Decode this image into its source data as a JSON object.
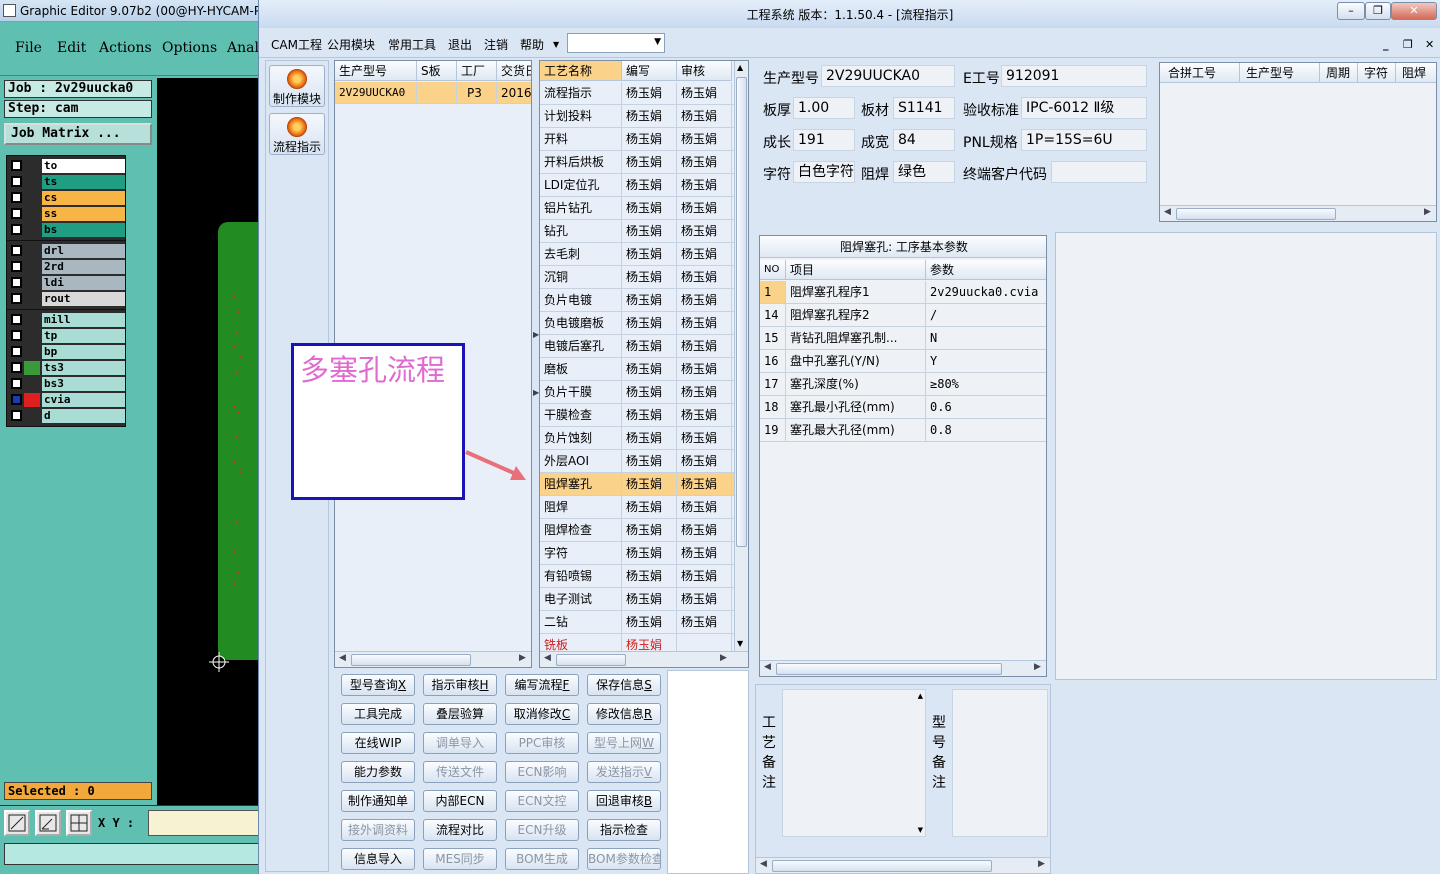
{
  "ge": {
    "title": "Graphic Editor 9.07b2 (00@HY-HYCAM-P",
    "menu": [
      "File",
      "Edit",
      "Actions",
      "Options",
      "Anal"
    ],
    "job": "Job : 2v29uucka0",
    "step": "Step: cam",
    "job_matrix": "Job Matrix ...",
    "layer_groups": [
      [
        {
          "name": "to",
          "color": "#ffffff"
        },
        {
          "name": "ts",
          "color": "#1f9e84"
        },
        {
          "name": "cs",
          "color": "#f6b544"
        },
        {
          "name": "ss",
          "color": "#f6b544"
        },
        {
          "name": "bs",
          "color": "#1f9e84"
        }
      ],
      [
        {
          "name": "drl",
          "color": "#a9b8c0"
        },
        {
          "name": "2rd",
          "color": "#a9b8c0"
        },
        {
          "name": "ldi",
          "color": "#a9b8c0"
        },
        {
          "name": "rout",
          "color": "#d8d8d8"
        }
      ],
      [
        {
          "name": "mill",
          "color": "#a8dcd5"
        },
        {
          "name": "tp",
          "color": "#a8dcd5"
        },
        {
          "name": "bp",
          "color": "#a8dcd5"
        },
        {
          "name": "ts3",
          "color": "#a8dcd5"
        },
        {
          "name": "bs3",
          "color": "#a8dcd5"
        },
        {
          "name": "cvia",
          "color": "#a8dcd5"
        },
        {
          "name": "d",
          "color": "#a8dcd5"
        }
      ]
    ],
    "selected": "Selected : 0",
    "xy_label": "X Y :"
  },
  "window": {
    "title": "工程系统   版本：1.1.50.4 - [流程指示]"
  },
  "menu": [
    "CAM工程",
    "公用模块",
    "常用工具",
    "退出",
    "注销",
    "帮助"
  ],
  "tools": [
    {
      "label": "制作模块",
      "icon": "gear-fire-icon"
    },
    {
      "label": "流程指示",
      "icon": "pause-circle-icon"
    }
  ],
  "product_grid": {
    "headers": [
      "生产型号",
      "S板",
      "工厂",
      "交货日"
    ],
    "rows": [
      {
        "model": "2V29UUCKA0",
        "s": "",
        "factory": "P3",
        "date": "2016/"
      }
    ]
  },
  "process_grid": {
    "headers": [
      "工艺名称",
      "编写",
      "审核"
    ],
    "rows": [
      {
        "name": "流程指示",
        "author": "杨玉娟",
        "reviewer": "杨玉娟"
      },
      {
        "name": "计划投料",
        "author": "杨玉娟",
        "reviewer": "杨玉娟"
      },
      {
        "name": "开料",
        "author": "杨玉娟",
        "reviewer": "杨玉娟"
      },
      {
        "name": "开料后烘板",
        "author": "杨玉娟",
        "reviewer": "杨玉娟"
      },
      {
        "name": "LDI定位孔",
        "author": "杨玉娟",
        "reviewer": "杨玉娟"
      },
      {
        "name": "铝片钻孔",
        "author": "杨玉娟",
        "reviewer": "杨玉娟"
      },
      {
        "name": "钻孔",
        "author": "杨玉娟",
        "reviewer": "杨玉娟"
      },
      {
        "name": "去毛刺",
        "author": "杨玉娟",
        "reviewer": "杨玉娟"
      },
      {
        "name": "沉铜",
        "author": "杨玉娟",
        "reviewer": "杨玉娟"
      },
      {
        "name": "负片电镀",
        "author": "杨玉娟",
        "reviewer": "杨玉娟"
      },
      {
        "name": "负电镀磨板",
        "author": "杨玉娟",
        "reviewer": "杨玉娟"
      },
      {
        "name": "电镀后塞孔",
        "author": "杨玉娟",
        "reviewer": "杨玉娟"
      },
      {
        "name": "磨板",
        "author": "杨玉娟",
        "reviewer": "杨玉娟"
      },
      {
        "name": "负片干膜",
        "author": "杨玉娟",
        "reviewer": "杨玉娟"
      },
      {
        "name": "干膜检查",
        "author": "杨玉娟",
        "reviewer": "杨玉娟"
      },
      {
        "name": "负片蚀刻",
        "author": "杨玉娟",
        "reviewer": "杨玉娟"
      },
      {
        "name": "外层AOI",
        "author": "杨玉娟",
        "reviewer": "杨玉娟"
      },
      {
        "name": "阻焊塞孔",
        "author": "杨玉娟",
        "reviewer": "杨玉娟",
        "selected": true
      },
      {
        "name": "阻焊",
        "author": "杨玉娟",
        "reviewer": "杨玉娟"
      },
      {
        "name": "阻焊检查",
        "author": "杨玉娟",
        "reviewer": "杨玉娟"
      },
      {
        "name": "字符",
        "author": "杨玉娟",
        "reviewer": "杨玉娟"
      },
      {
        "name": "有铅喷锡",
        "author": "杨玉娟",
        "reviewer": "杨玉娟"
      },
      {
        "name": "电子测试",
        "author": "杨玉娟",
        "reviewer": "杨玉娟"
      },
      {
        "name": "二钻",
        "author": "杨玉娟",
        "reviewer": "杨玉娟"
      },
      {
        "name": "铣板",
        "author": "杨玉娟",
        "reviewer": "",
        "partial": true
      }
    ]
  },
  "info": {
    "model_label": "生产型号",
    "model": "2V29UUCKA0",
    "eno_label": "E工号",
    "eno": "912091",
    "thickness_label": "板厚",
    "thickness": "1.00",
    "material_label": "板材",
    "material": "S1141",
    "standard_label": "验收标准",
    "standard": "IPC-6012 Ⅱ级",
    "length_label": "成长",
    "length": "191",
    "width_label": "成宽",
    "width": "84",
    "pnl_label": "PNL规格",
    "pnl": "1P=15S=6U",
    "char_label": "字符",
    "char": "白色字符",
    "mask_label": "阻焊",
    "mask": "绿色",
    "customer_label": "终端客户代码",
    "customer": ""
  },
  "merge_grid": {
    "headers": [
      "合拼工号",
      "生产型号",
      "周期",
      "字符",
      "阻焊"
    ]
  },
  "param_grid": {
    "title": "阻焊塞孔: 工序基本参数",
    "headers": [
      "NO",
      "项目",
      "参数"
    ],
    "rows": [
      {
        "no": "1",
        "item": "阻焊塞孔程序1",
        "value": "2v29uucka0.cvia",
        "selected": true
      },
      {
        "no": "14",
        "item": "阻焊塞孔程序2",
        "value": "/"
      },
      {
        "no": "15",
        "item": "背钻孔阻焊塞孔制...",
        "value": "N"
      },
      {
        "no": "16",
        "item": "盘中孔塞孔(Y/N)",
        "value": "Y"
      },
      {
        "no": "17",
        "item": "塞孔深度(%)",
        "value": "≥80%"
      },
      {
        "no": "18",
        "item": "塞孔最小孔径(mm)",
        "value": "0.6"
      },
      {
        "no": "19",
        "item": "塞孔最大孔径(mm)",
        "value": "0.8"
      }
    ]
  },
  "buttons": [
    [
      {
        "label": "型号查询",
        "key": "X"
      },
      {
        "label": "指示审核",
        "key": "H"
      },
      {
        "label": "编写流程",
        "key": "F"
      },
      {
        "label": "保存信息",
        "key": "S"
      }
    ],
    [
      {
        "label": "工具完成",
        "key": ""
      },
      {
        "label": "叠层验算",
        "key": ""
      },
      {
        "label": "取消修改",
        "key": "C"
      },
      {
        "label": "修改信息",
        "key": "R"
      }
    ],
    [
      {
        "label": "在线WIP",
        "key": ""
      },
      {
        "label": "调单导入",
        "key": "",
        "disabled": true
      },
      {
        "label": "PPC审核",
        "key": "",
        "disabled": true
      },
      {
        "label": "型号上网",
        "key": "W",
        "disabled": true
      }
    ],
    [
      {
        "label": "能力参数",
        "key": ""
      },
      {
        "label": "传送文件",
        "key": "",
        "disabled": true
      },
      {
        "label": "ECN影响",
        "key": "",
        "disabled": true
      },
      {
        "label": "发送指示",
        "key": "V",
        "disabled": true
      }
    ],
    [
      {
        "label": "制作通知单",
        "key": ""
      },
      {
        "label": "内部ECN",
        "key": ""
      },
      {
        "label": "ECN文控",
        "key": "",
        "disabled": true
      },
      {
        "label": "回退审核",
        "key": "B"
      }
    ],
    [
      {
        "label": "接外调资料",
        "key": "",
        "disabled": true
      },
      {
        "label": "流程对比",
        "key": ""
      },
      {
        "label": "ECN升级",
        "key": "",
        "disabled": true
      },
      {
        "label": "指示检查",
        "key": ""
      }
    ],
    [
      {
        "label": "信息导入",
        "key": ""
      },
      {
        "label": "MES同步",
        "key": "",
        "disabled": true
      },
      {
        "label": "BOM生成",
        "key": "",
        "disabled": true
      },
      {
        "label": "BOM参数检查",
        "key": "",
        "disabled": true
      }
    ]
  ],
  "remarks": {
    "process_label": "工艺备注",
    "model_label": "型号备注"
  },
  "annotation": {
    "text": "多塞孔流程",
    "border_color": "#1a14b8",
    "text_color": "#e06ad0",
    "arrow_color": "#e8707a"
  }
}
